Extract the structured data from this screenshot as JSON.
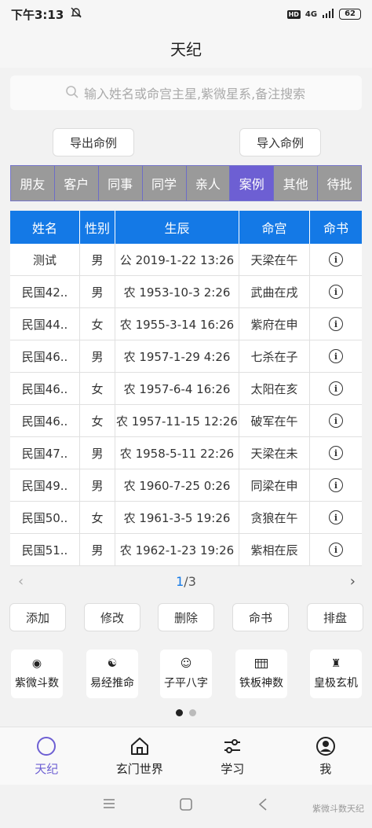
{
  "status": {
    "time": "下午3:13",
    "hd": "HD",
    "signal": "4G",
    "battery": "62"
  },
  "header": {
    "title": "天纪"
  },
  "search": {
    "placeholder": "输入姓名或命宫主星,紫微星系,备注搜索"
  },
  "top_buttons": {
    "export_label": "导出命例",
    "import_label": "导入命例"
  },
  "tabs": [
    {
      "label": "朋友",
      "active": false
    },
    {
      "label": "客户",
      "active": false
    },
    {
      "label": "同事",
      "active": false
    },
    {
      "label": "同学",
      "active": false
    },
    {
      "label": "亲人",
      "active": false
    },
    {
      "label": "案例",
      "active": true
    },
    {
      "label": "其他",
      "active": false
    },
    {
      "label": "待批",
      "active": false
    }
  ],
  "table": {
    "headers": [
      "姓名",
      "性别",
      "生辰",
      "命宫",
      "命书"
    ],
    "rows": [
      {
        "name": "测试",
        "gender": "男",
        "birth": "公 2019-1-22 13:26",
        "palace": "天梁在午"
      },
      {
        "name": "民国42..",
        "gender": "男",
        "birth": "农 1953-10-3 2:26",
        "palace": "武曲在戌"
      },
      {
        "name": "民国44..",
        "gender": "女",
        "birth": "农 1955-3-14 16:26",
        "palace": "紫府在申"
      },
      {
        "name": "民国46..",
        "gender": "男",
        "birth": "农 1957-1-29 4:26",
        "palace": "七杀在子"
      },
      {
        "name": "民国46..",
        "gender": "女",
        "birth": "农 1957-6-4 16:26",
        "palace": "太阳在亥"
      },
      {
        "name": "民国46..",
        "gender": "女",
        "birth": "农 1957-11-15 12:26",
        "palace": "破军在午"
      },
      {
        "name": "民国47..",
        "gender": "男",
        "birth": "农 1958-5-11 22:26",
        "palace": "天梁在未"
      },
      {
        "name": "民国49..",
        "gender": "男",
        "birth": "农 1960-7-25 0:26",
        "palace": "同梁在申"
      },
      {
        "name": "民国50..",
        "gender": "女",
        "birth": "农 1961-3-5 19:26",
        "palace": "贪狼在午"
      },
      {
        "name": "民国51..",
        "gender": "男",
        "birth": "农 1962-1-23 19:26",
        "palace": "紫相在辰"
      }
    ]
  },
  "pager": {
    "current": "1",
    "total": "/3"
  },
  "actions": {
    "add": "添加",
    "edit": "修改",
    "delete": "删除",
    "book": "命书",
    "chart": "排盘"
  },
  "tools": [
    {
      "label": "紫微斗数",
      "icon": "star-target-icon"
    },
    {
      "label": "易经推命",
      "icon": "yin-yang-icon"
    },
    {
      "label": "子平八字",
      "icon": "face-icon"
    },
    {
      "label": "铁板神数",
      "icon": "abacus-icon"
    },
    {
      "label": "皇极玄机",
      "icon": "figure-icon"
    }
  ],
  "bottom_nav": [
    {
      "label": "天纪",
      "active": true
    },
    {
      "label": "玄门世界",
      "active": false
    },
    {
      "label": "学习",
      "active": false
    },
    {
      "label": "我",
      "active": false
    }
  ],
  "watermark": "紫微斗数天纪",
  "colors": {
    "accent": "#6d5fd3",
    "table_header": "#1479e6",
    "tab_bg": "#9a9a9a"
  }
}
